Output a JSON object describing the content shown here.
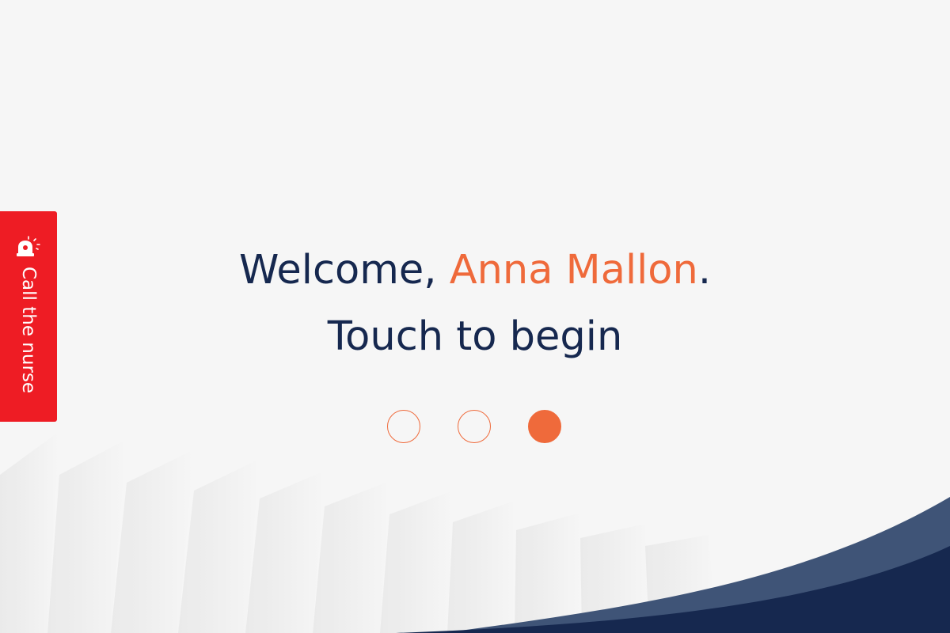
{
  "call_nurse": {
    "label": "Call the nurse",
    "icon": "alarm-siren-icon",
    "color": "#ee1c24"
  },
  "welcome": {
    "prefix": "Welcome, ",
    "patient_name": "Anna Mallon",
    "suffix": "."
  },
  "prompt": "Touch to begin",
  "progress": {
    "total": 3,
    "filled_index": 2,
    "accent": "#ef6a3b"
  },
  "colors": {
    "text": "#16284f",
    "accent": "#ef6a3b",
    "wave": "#16284f",
    "background": "#f6f6f6"
  }
}
